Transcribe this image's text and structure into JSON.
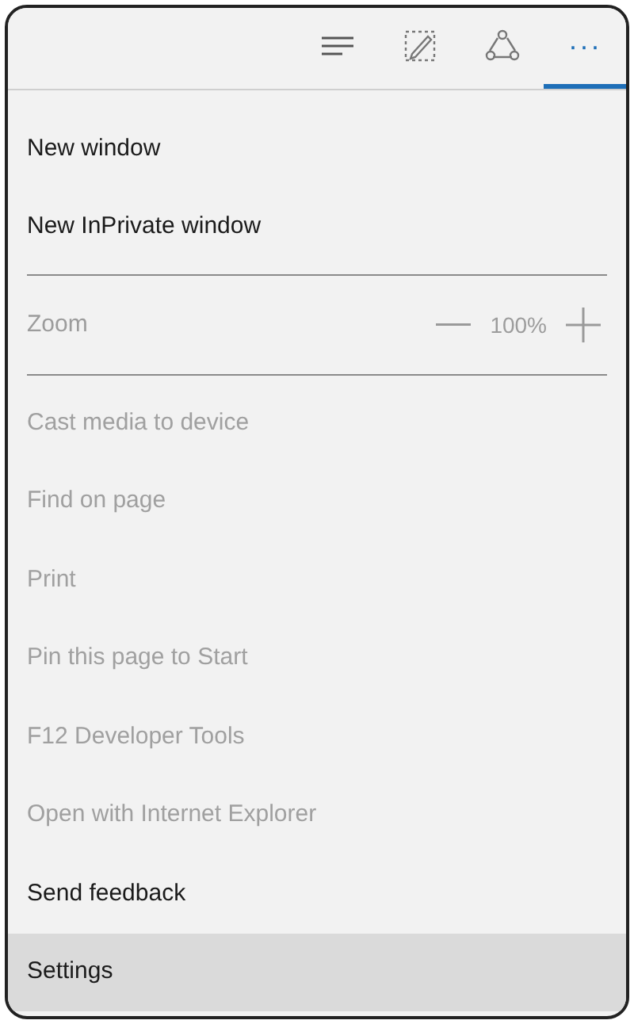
{
  "toolbar": [
    {
      "kind": "hub",
      "selected": false
    },
    {
      "kind": "note",
      "selected": false
    },
    {
      "kind": "share",
      "selected": false
    },
    {
      "kind": "more",
      "label": "···",
      "selected": true
    }
  ],
  "menu": [
    {
      "kind": "item",
      "label": "New window",
      "disabled": false,
      "selected": false
    },
    {
      "kind": "item",
      "label": "New InPrivate window",
      "disabled": false,
      "selected": false
    },
    {
      "kind": "divider"
    },
    {
      "kind": "zoom",
      "label": "Zoom",
      "value": "100%",
      "disabled": true
    },
    {
      "kind": "divider"
    },
    {
      "kind": "item",
      "label": "Cast media to device",
      "disabled": true,
      "selected": false
    },
    {
      "kind": "item",
      "label": "Find on page",
      "disabled": true,
      "selected": false
    },
    {
      "kind": "item",
      "label": "Print",
      "disabled": true,
      "selected": false
    },
    {
      "kind": "item",
      "label": "Pin this page to Start",
      "disabled": true,
      "selected": false
    },
    {
      "kind": "item",
      "label": "F12 Developer Tools",
      "disabled": true,
      "selected": false
    },
    {
      "kind": "item",
      "label": "Open with Internet Explorer",
      "disabled": true,
      "selected": false
    },
    {
      "kind": "item",
      "label": "Send feedback",
      "disabled": false,
      "selected": false
    },
    {
      "kind": "item",
      "label": "Settings",
      "disabled": false,
      "selected": true
    }
  ]
}
